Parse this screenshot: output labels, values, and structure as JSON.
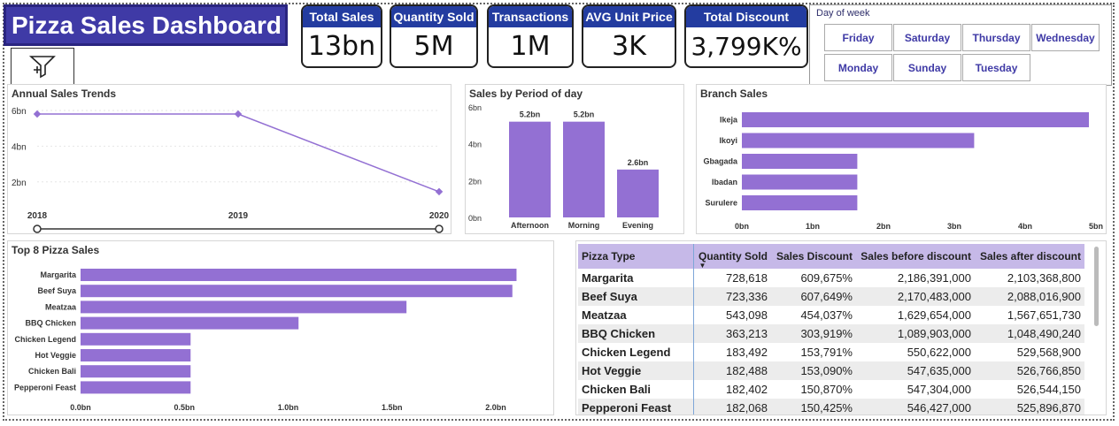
{
  "header": {
    "title": "Pizza Sales Dashboard"
  },
  "kpis": [
    {
      "label": "Total Sales",
      "value": "13bn"
    },
    {
      "label": "Quantity Sold",
      "value": "5M"
    },
    {
      "label": "Transactions",
      "value": "1M"
    },
    {
      "label": "AVG Unit Price",
      "value": "3K"
    },
    {
      "label": "Total Discount",
      "value": "3,799K%"
    }
  ],
  "day_of_week": {
    "title": "Day of week",
    "days": [
      "Friday",
      "Saturday",
      "Thursday",
      "Wednesday",
      "Monday",
      "Sunday",
      "Tuesday"
    ]
  },
  "colors": {
    "accent": "#9370d3",
    "title_bg": "#3f3aa6",
    "kpi_head": "#233ca0",
    "table_head": "#c6b9e8"
  },
  "chart_data": [
    {
      "type": "line",
      "title": "Annual Sales Trends",
      "x": [
        "2018",
        "2019",
        "2020"
      ],
      "values": [
        5.8,
        5.8,
        1.45
      ],
      "yticks": [
        "6bn",
        "4bn",
        "2bn"
      ],
      "ylim": [
        1,
        6
      ]
    },
    {
      "type": "bar",
      "title": "Sales by Period of day",
      "categories": [
        "Afternoon",
        "Morning",
        "Evening"
      ],
      "values": [
        5.2,
        5.2,
        2.6
      ],
      "labels": [
        "5.2bn",
        "5.2bn",
        "2.6bn"
      ],
      "yticks": [
        "6bn",
        "4bn",
        "2bn",
        "0bn"
      ],
      "ylim": [
        0,
        6
      ]
    },
    {
      "type": "bar",
      "orientation": "horizontal",
      "title": "Branch Sales",
      "categories": [
        "Ikeja",
        "Ikoyi",
        "Gbagada",
        "Ibadan",
        "Surulere"
      ],
      "values": [
        4.9,
        3.28,
        1.63,
        1.63,
        1.63
      ],
      "xticks": [
        "0bn",
        "1bn",
        "2bn",
        "3bn",
        "4bn",
        "5bn"
      ],
      "xlim": [
        0,
        5
      ]
    },
    {
      "type": "bar",
      "orientation": "horizontal",
      "title": "Top 8 Pizza Sales",
      "categories": [
        "Margarita",
        "Beef Suya",
        "Meatzaa",
        "BBQ Chicken",
        "Chicken Legend",
        "Hot Veggie",
        "Chicken Bali",
        "Pepperoni Feast"
      ],
      "values": [
        2.1,
        2.08,
        1.57,
        1.05,
        0.53,
        0.53,
        0.53,
        0.53
      ],
      "xticks": [
        "0.0bn",
        "0.5bn",
        "1.0bn",
        "1.5bn",
        "2.0bn"
      ],
      "xlim": [
        0,
        2.25
      ]
    }
  ],
  "table": {
    "columns": [
      "Pizza Type",
      "Quantity Sold",
      "Sales Discount",
      "Sales before discount",
      "Sales after discount"
    ],
    "rows": [
      [
        "Margarita",
        "728,618",
        "609,675%",
        "2,186,391,000",
        "2,103,368,800"
      ],
      [
        "Beef Suya",
        "723,336",
        "607,649%",
        "2,170,483,000",
        "2,088,016,900"
      ],
      [
        "Meatzaa",
        "543,098",
        "454,037%",
        "1,629,654,000",
        "1,567,651,730"
      ],
      [
        "BBQ Chicken",
        "363,213",
        "303,919%",
        "1,089,903,000",
        "1,048,490,240"
      ],
      [
        "Chicken Legend",
        "183,492",
        "153,791%",
        "550,622,000",
        "529,568,900"
      ],
      [
        "Hot Veggie",
        "182,488",
        "153,090%",
        "547,635,000",
        "526,766,850"
      ],
      [
        "Chicken Bali",
        "182,402",
        "150,870%",
        "547,304,000",
        "526,544,150"
      ],
      [
        "Pepperoni Feast",
        "182,068",
        "150,425%",
        "546,427,000",
        "525,896,870"
      ]
    ]
  }
}
